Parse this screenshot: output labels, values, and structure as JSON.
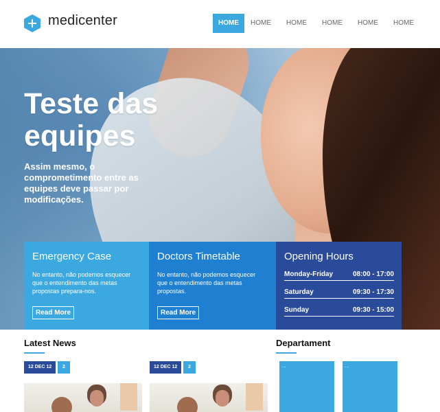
{
  "header": {
    "brand": "medicenter",
    "nav": [
      "HOME",
      "HOME",
      "HOME",
      "HOME",
      "HOME",
      "HOME"
    ]
  },
  "hero": {
    "title": "Teste das equipes",
    "subtitle": "Assim mesmo, o comprometimento entre as equipes deve passar por modificações."
  },
  "boxes": {
    "emergency": {
      "title": "Emergency Case",
      "text": "No entanto, não podemos esquecer que o entendimento das metas propostas prepara-nos.",
      "button": "Read More"
    },
    "doctors": {
      "title": "Doctors Timetable",
      "text": "No entanto, não podemos esquecer que o entendimento das metas propostas.",
      "button": "Read More"
    },
    "hours": {
      "title": "Opening Hours",
      "rows": [
        {
          "day": "Monday-Friday",
          "time": "08:00 - 17:00"
        },
        {
          "day": "Saturday",
          "time": "09:30 - 17:30"
        },
        {
          "day": "Sunday",
          "time": "09:30 - 15:00"
        }
      ]
    }
  },
  "latest_news": {
    "title": "Latest News",
    "items": [
      {
        "date": "12 DEC 12",
        "comments": "2"
      },
      {
        "date": "12 DEC 12",
        "comments": "2"
      }
    ]
  },
  "department": {
    "title": "Departament",
    "tiles": [
      "...",
      "..."
    ]
  },
  "colors": {
    "accent": "#3ba8e0",
    "blue_mid": "#1f7fd0",
    "blue_dark": "#2a4a9a"
  }
}
